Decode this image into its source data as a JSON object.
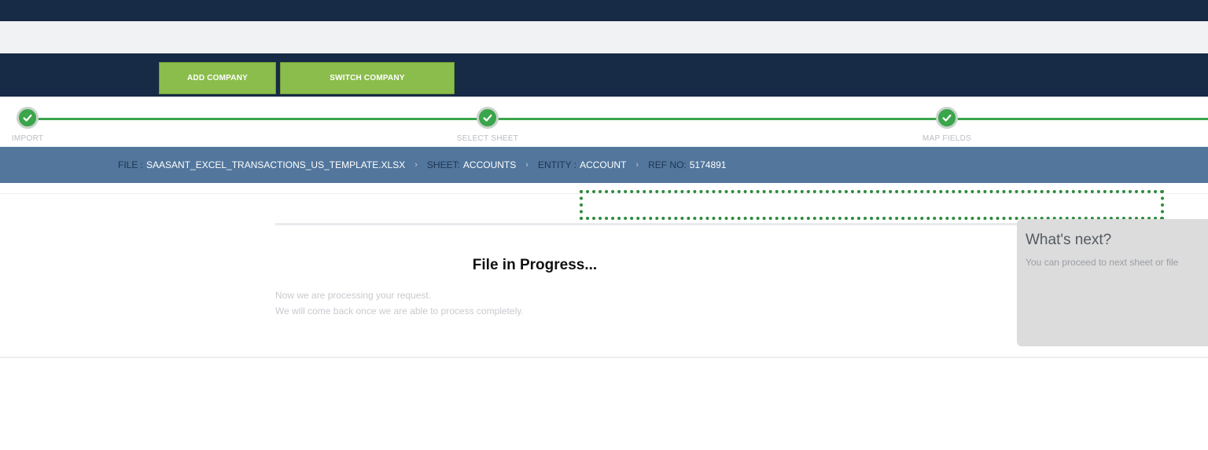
{
  "header": {
    "add_company_label": "ADD COMPANY",
    "switch_company_label": "SWITCH COMPANY"
  },
  "steps": [
    {
      "label": "IMPORT",
      "status": "complete"
    },
    {
      "label": "SELECT SHEET",
      "status": "complete"
    },
    {
      "label": "MAP FIELDS",
      "status": "complete"
    }
  ],
  "breadcrumb": {
    "file_key": "FILE :",
    "file_value": "SAASANT_EXCEL_TRANSACTIONS_US_TEMPLATE.XLSX",
    "sheet_key": "SHEET:",
    "sheet_value": "ACCOUNTS",
    "entity_key": "ENTITY :",
    "entity_value": "ACCOUNT",
    "ref_key": "REF NO:",
    "ref_value": "5174891",
    "separator": "›"
  },
  "progress": {
    "title": "File in Progress...",
    "line1": "Now we are processing your request.",
    "line2": "We will come back once we are able to process completely."
  },
  "whats_next": {
    "title": "What's next?",
    "subtitle": "You can proceed to next sheet or file"
  },
  "colors": {
    "navy": "#172a46",
    "accent_green": "#8bbd4c",
    "step_green": "#3aa54a",
    "breadcrumb_blue": "#52769c"
  }
}
